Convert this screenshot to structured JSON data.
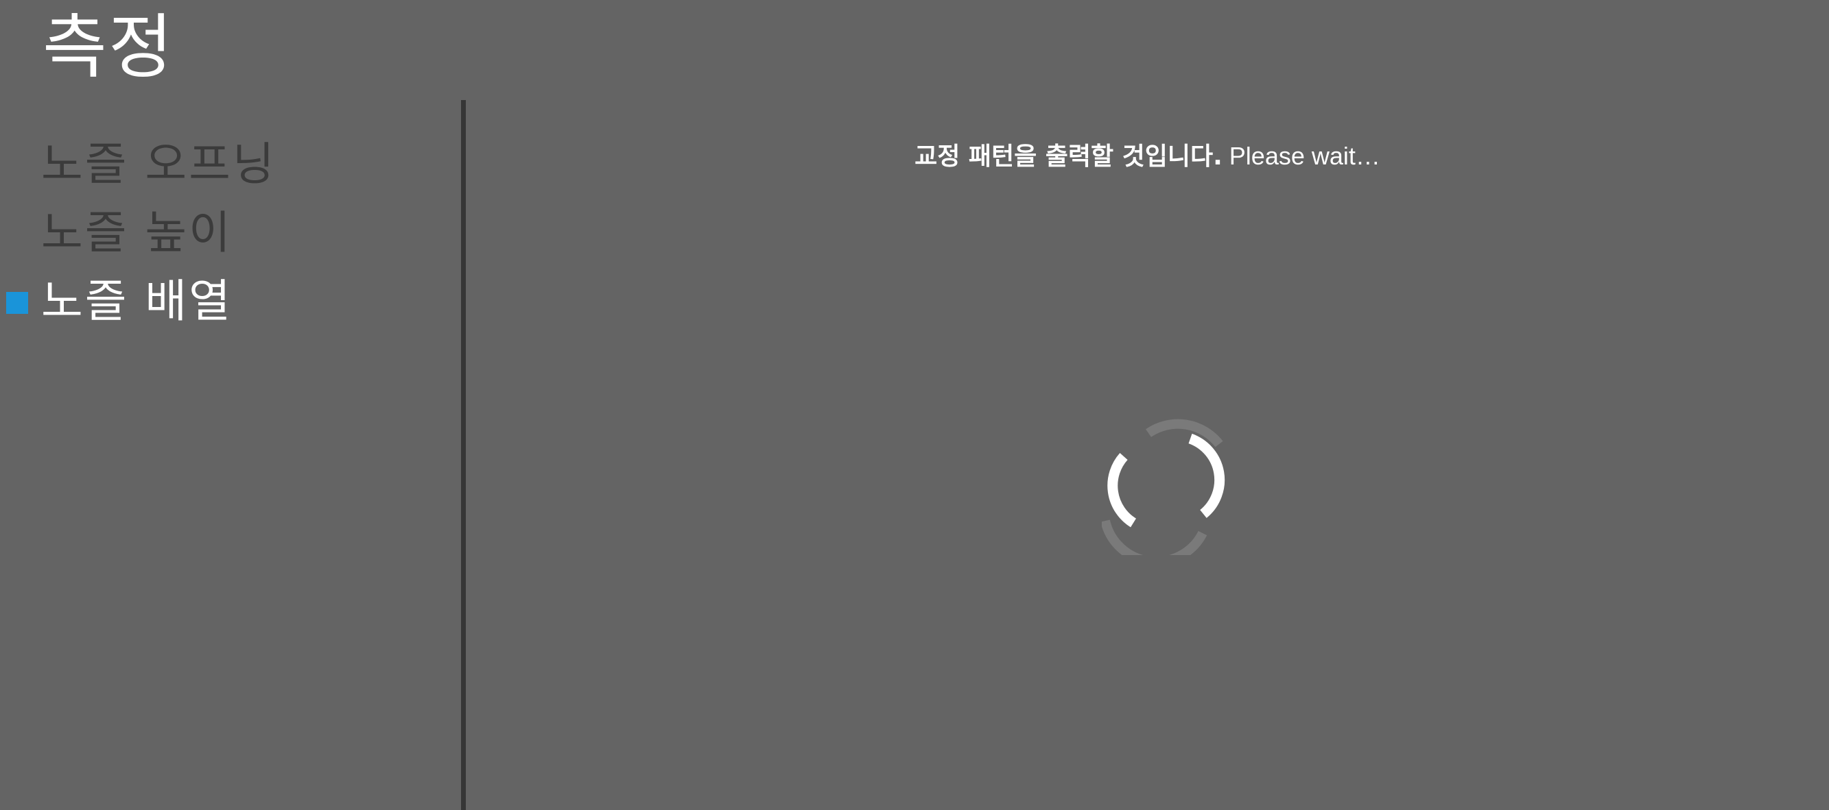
{
  "page": {
    "title": "측정"
  },
  "sidebar": {
    "items": [
      {
        "label": "노즐 오프닝",
        "active": false
      },
      {
        "label": "노즐 높이",
        "active": false
      },
      {
        "label": "노즐 배열",
        "active": true
      }
    ]
  },
  "main": {
    "status_message_ko": "교정 패턴을 출력할 것입니다.",
    "status_message_en": " Please wait…",
    "spinner_icon": "loading-spinner-icon"
  },
  "colors": {
    "background": "#646464",
    "accent": "#1a94d9",
    "divider": "#363636",
    "inactive_text": "#3b3b3b",
    "active_text": "#ffffff"
  }
}
